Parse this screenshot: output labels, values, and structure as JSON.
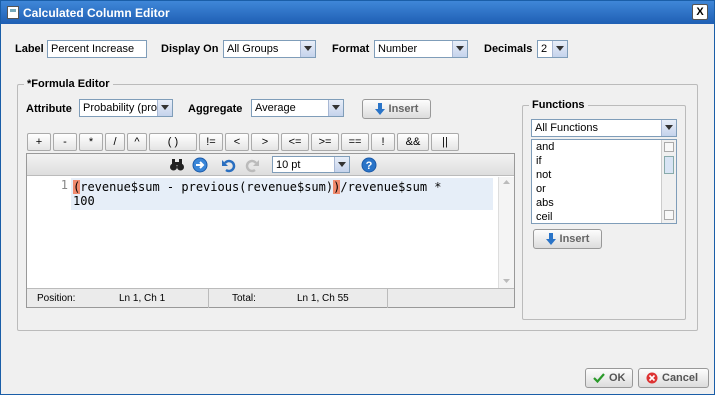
{
  "window": {
    "title": "Calculated Column Editor",
    "close": "X"
  },
  "top": {
    "label_label": "Label",
    "label_value": "Percent Increase",
    "display_on_label": "Display On",
    "display_on_value": "All Groups",
    "format_label": "Format",
    "format_value": "Number",
    "decimals_label": "Decimals",
    "decimals_value": "2"
  },
  "formula_editor": {
    "legend": "*Formula Editor",
    "attribute_label": "Attribute",
    "attribute_value": "Probability (pro",
    "aggregate_label": "Aggregate",
    "aggregate_value": "Average",
    "insert_label": "Insert",
    "operators": [
      "+",
      "-",
      "*",
      "/",
      "^",
      "( )",
      "!=",
      "<",
      ">",
      "<=",
      ">=",
      "==",
      "!",
      "&&",
      "||"
    ],
    "font_size": "10 pt",
    "line_number": "1",
    "code_line1_open": "(",
    "code_line1_mid": "revenue$sum - previous(revenue$sum)",
    "code_line1_close": ")",
    "code_line1_tail": "/revenue$sum *",
    "code_line2": "100",
    "status": {
      "position_label": "Position:",
      "position_value": "Ln 1, Ch 1",
      "total_label": "Total:",
      "total_value": "Ln 1, Ch 55"
    }
  },
  "functions": {
    "legend": "Functions",
    "category": "All Functions",
    "items": [
      "and",
      "if",
      "not",
      "or",
      "abs",
      "ceil"
    ],
    "insert_label": "Insert"
  },
  "footer": {
    "ok_label": "OK",
    "cancel_label": "Cancel"
  },
  "colors": {
    "title_bar": "#1f5fb4",
    "bracket_highlight": "#f08a6e",
    "ok_icon": "#2a9a2a",
    "cancel_icon": "#d33"
  }
}
